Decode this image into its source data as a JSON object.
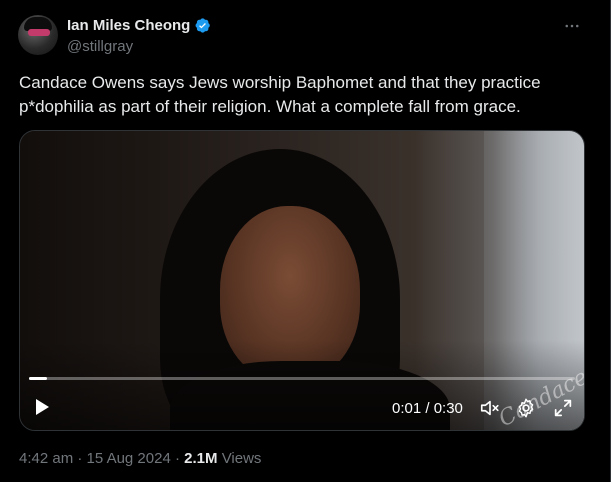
{
  "author": {
    "display_name": "Ian Miles Cheong",
    "handle": "@stillgray",
    "verified_icon": "verified-badge-icon",
    "verified_color": "#1d9bf0"
  },
  "more_icon": "more-horizontal-icon",
  "tweet": {
    "text": "Candace Owens says Jews worship Baphomet and that they practice p*dophilia as part of their religion. What a complete fall from grace."
  },
  "video": {
    "time_display": "0:01 / 0:30",
    "progress": 0.033,
    "watermark": "Candace",
    "controls": {
      "play_icon": "play-icon",
      "mute_icon": "muted-speaker-icon",
      "settings_icon": "gear-icon",
      "fullscreen_icon": "fullscreen-icon"
    }
  },
  "meta": {
    "time": "4:42 am",
    "separator": "·",
    "date": "15 Aug 2024",
    "views_count": "2.1M",
    "views_label": "Views"
  },
  "colors": {
    "background": "#000000",
    "text_primary": "#e7e9ea",
    "text_secondary": "#71767b",
    "border": "#2f3336"
  }
}
